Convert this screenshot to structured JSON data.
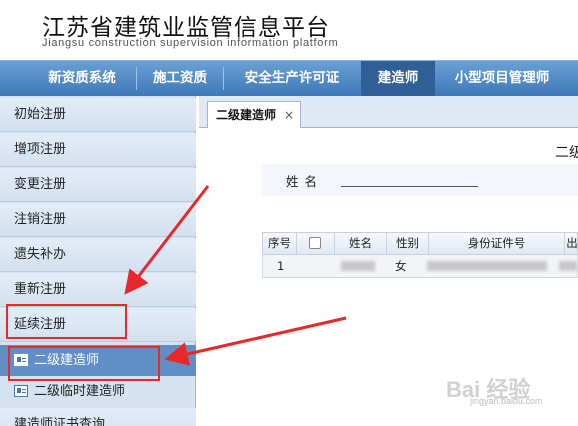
{
  "header": {
    "title": "江苏省建筑业监管信息平台",
    "subtitle": "Jiangsu construction supervision information platform"
  },
  "nav": {
    "items": [
      {
        "label": "新资质系统"
      },
      {
        "label": "施工资质"
      },
      {
        "label": "安全生产许可证"
      },
      {
        "label": "建造师",
        "active": true
      },
      {
        "label": "小型项目管理师"
      }
    ]
  },
  "sidebar": {
    "items": [
      {
        "label": "初始注册"
      },
      {
        "label": "增项注册"
      },
      {
        "label": "变更注册"
      },
      {
        "label": "注销注册"
      },
      {
        "label": "遗失补办"
      },
      {
        "label": "重新注册"
      },
      {
        "label": "延续注册"
      }
    ],
    "sub_items": [
      {
        "label": "二级建造师",
        "active": true
      },
      {
        "label": "二级临时建造师"
      }
    ],
    "next_item": {
      "label": "建造师证书查询"
    }
  },
  "tabs": {
    "active_label": "二级建造师",
    "close_glyph": "×"
  },
  "form": {
    "title": "二级",
    "name_label": "姓名",
    "name_value": ""
  },
  "grid": {
    "columns": [
      "序号",
      "",
      "姓名",
      "性别",
      "身份证件号",
      "出"
    ],
    "rows": [
      {
        "index": "1",
        "name": "",
        "gender": "女",
        "id_number": ""
      }
    ]
  },
  "watermark": {
    "text": "Bai 经验",
    "sub": "jingyan.baidu.com"
  },
  "colors": {
    "nav_bg": "#3f78b8",
    "nav_active": "#2f5f94",
    "sidebar_bg": "#d5e2f0",
    "sub_active": "#5f8fc4",
    "annotation_red": "#e8282b"
  }
}
